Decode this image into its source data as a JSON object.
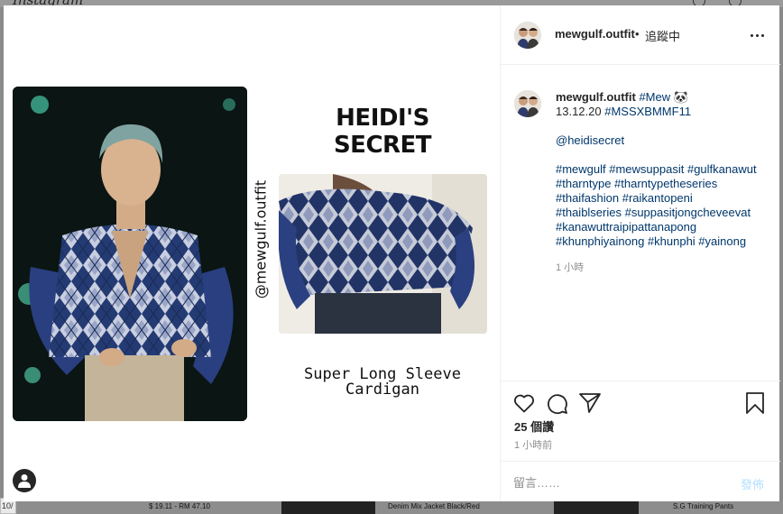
{
  "background": {
    "logo": "Instagram",
    "bottom_items": [
      "$ 19.11 - RM 47.10",
      "Denim Mix Jacket Black/Red",
      "S.G Training Pants"
    ],
    "page_counter": "10/"
  },
  "post": {
    "author": "mewgulf.outfit",
    "separator": "•",
    "follow_status": "追蹤中",
    "image": {
      "title": "HEIDI'S SECRET",
      "handle": "@mewgulf.outfit",
      "caption_line1": "Super Long Sleeve",
      "caption_line2": "Cardigan"
    },
    "caption": {
      "author": "mewgulf.outfit",
      "tag_first": "#Mew",
      "emoji": "🐼",
      "line2_date": "13.12.20",
      "line2_tag": "#MSSXBMMF11",
      "mention": "@heidisecret",
      "hashtag_lines": [
        "#mewgulf #mewsuppasit #gulfkanawut",
        "#tharntype #tharntypetheseries",
        "#thaifashion #raikantopeni",
        "#thaiblseries #suppasitjongcheveevat",
        "#kanawuttraipipattanapong",
        "#khunphiyainong #khunphi #yainong"
      ],
      "time": "1 小時"
    },
    "likes": "25 個讚",
    "posted": "1 小時前",
    "comment_placeholder": "留言……",
    "post_button": "發佈"
  },
  "icons": {
    "more": "more-options-icon",
    "like": "heart-icon",
    "comment": "comment-icon",
    "share": "share-icon",
    "save": "bookmark-icon",
    "user_tags": "user-tags-icon"
  },
  "colors": {
    "hashtag": "#00376b",
    "post_button_disabled": "#b2dffc",
    "muted": "#8e8e8e",
    "cardigan_navy": "#223366"
  }
}
